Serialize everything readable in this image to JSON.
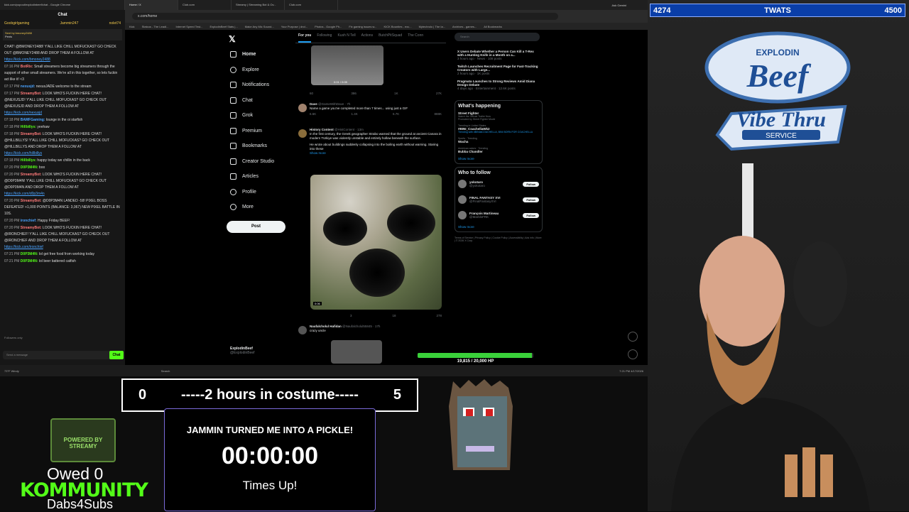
{
  "browser": {
    "tabs": [
      "Home / X",
      "Club.com",
      "Streamy | Streaming Bot & Ov...",
      "Club.com"
    ],
    "url": "x.com/home",
    "bookmarks": [
      "Kick",
      "Statcus - The Leadi...",
      "Internet Speed Test...",
      "ExplodinBeef Stats |...",
      "Make Any Mic Sound...",
      "Your Purpose | dnd...",
      "Photos - Google Ph...",
      "Fix gaming issues w...",
      "KICK Bounties - exc...",
      "Mytechrolo | The Ia...",
      "Archives - games...",
      "All Bookmarks"
    ],
    "ask_gemini": "Ask Gemini"
  },
  "chat": {
    "url": "kick.com/popout/explodinbeef/chat - Google Chrome",
    "title": "Chat",
    "top_left": "Goobgirlgaming",
    "top_mid": "Jammin247",
    "top_right": "nolet74",
    "pinned_by": "Sent by bmoney2488",
    "pinned_text": "Penis",
    "messages": [
      {
        "time": "",
        "user": "",
        "text": "CHAT! @BMONEY2488! Y'ALL LIKE CHILL MOFUCKAS? GO CHECK OUT @BMONEY2488 AND DROP THEM A FOLLOW AT",
        "link": "https://kick.com/bmoney2488"
      },
      {
        "time": "07:16 PM",
        "user": "BotRix:",
        "text": "Small streamers become big streamers through the support of other small streamers. We're all in this together, so lets fuckin act like it! <3",
        "link": ""
      },
      {
        "time": "07:17 PM",
        "user": "nexusjd:",
        "text": "nexusJADE welcome to the stream",
        "link": ""
      },
      {
        "time": "07:17 PM",
        "user": "StreamyBot:",
        "text": "LOOK WHO'S FUCKIN HERE CHAT! @NEXUSJD! Y'ALL LIKE CHILL MOFUCKAS? GO CHECK OUT @NEXUSJD AND DROP THEM A FOLLOW AT",
        "link": "https://kick.com/nexusjd"
      },
      {
        "time": "07:18 PM",
        "user": "BAMFGaming:",
        "text": "lounge in the oi starfish",
        "link": ""
      },
      {
        "time": "07:18 PM",
        "user": "Hillbillys:",
        "text": "yeehaw",
        "link": ""
      },
      {
        "time": "07:18 PM",
        "user": "StreamyBot:",
        "text": "LOOK WHO'S FUCKIN HERE CHAT! @HILLBILLYS! Y'ALL LIKE CHILL MOFUCKAS? GO CHECK OUT @HILLBILLYS AND DROP THEM A FOLLOW AT",
        "link": "https://kick.com/hillbillys"
      },
      {
        "time": "07:18 PM",
        "user": "Hillbillys:",
        "text": "happy today we chillin in the back",
        "link": ""
      },
      {
        "time": "07:20 PM",
        "user": "D0P3M4N:",
        "text": "boo",
        "link": ""
      },
      {
        "time": "07:20 PM",
        "user": "StreamyBot:",
        "text": "LOOK WHO'S FUCKIN HERE CHAT! @D0P3M4N! Y'ALL LIKE CHILL MOFUCKAS? GO CHECK OUT @D0P3M4N AND DROP THEM A FOLLOW AT",
        "link": "https://kick.com/d0p3m4n"
      },
      {
        "time": "07:20 PM",
        "user": "StreamyBot:",
        "text": "@D0P3M4N LANDED -58! PIXEL BOSS DEFEATED! +1,000 POINTS (BALANCE: 3,067) NEW PIXEL BATTLE IN 10S.",
        "link": ""
      },
      {
        "time": "07:20 PM",
        "user": "ironchief:",
        "text": "Happy Friday BEEF!",
        "link": ""
      },
      {
        "time": "07:20 PM",
        "user": "StreamyBot:",
        "text": "LOOK WHO'S FUCKIN HERE CHAT! @IRONCHIEF! Y'ALL LIKE CHILL MOFUCKAS? GO CHECK OUT @IRONCHIEF AND DROP THEM A FOLLOW AT",
        "link": "https://kick.com/ironchief"
      },
      {
        "time": "07:21 PM",
        "user": "D0P3M4N:",
        "text": "lol get free food from working today",
        "link": ""
      },
      {
        "time": "07:21 PM",
        "user": "D0P3M4N:",
        "text": "lol beer battered catfish",
        "link": ""
      }
    ],
    "followers_only": "Followers only",
    "input_placeholder": "Send a message",
    "send_label": "Chat"
  },
  "x": {
    "nav": [
      "Home",
      "Explore",
      "Notifications",
      "Chat",
      "Grok",
      "Premium",
      "Bookmarks",
      "Creator Studio",
      "Articles",
      "Profile",
      "More"
    ],
    "post_label": "Post",
    "profile_name": "ExplodinBeef",
    "profile_handle": "@ExplodinBeef",
    "feed_tabs": [
      "For you",
      "Following",
      "Kush N Tell",
      "Actions",
      "ButchPitSquad",
      "The Conn"
    ],
    "tweet1": {
      "time_code": "0:01 / 0:05",
      "stats": [
        "60",
        "386",
        "1K",
        "27K"
      ]
    },
    "tweet2": {
      "name": "Dave",
      "handle": "@GameWithDave · 7h",
      "text": "Name a game you've completed more than 7 times... using just a GIF",
      "stats": [
        "6.6K",
        "1.4K",
        "6.7K",
        "888K"
      ]
    },
    "tweet3": {
      "name": "History Content",
      "handle": "@HistContent · 13m",
      "text": "In the first century, the Greek geographer Strabo warned that the ground at ancient Canara in modern Türkiye was violently unstable and entirely hollow beneath the surface.",
      "text2": "He wrote about buildings suddenly collapsing into the boiling earth without warning. Staring into these",
      "show_more": "Show more",
      "video_time": "0:06",
      "stats": [
        "",
        "3",
        "18",
        "278"
      ]
    },
    "tweet4": {
      "name": "Naufalcholul Hafidan",
      "handle": "@Naufalcholul55845 · 17h",
      "text": "crazy uncle"
    },
    "search_placeholder": "Search",
    "news": [
      {
        "title": "X Users Debate Whether a Person Can Kill a T-Rex with a Hunting Knife in a Month on a...",
        "meta": "3 hours ago · News · 108 posts"
      },
      {
        "title": "Twitch Launches Recruitment Page for Fast-Tracking Creators with Large...",
        "meta": "2 hours ago · 1K posts"
      },
      {
        "title": "Pragmata Launches to Strong Reviews Amid Diana Design Debate",
        "meta": "4 days ago · Entertainment · 12.6K posts"
      }
    ],
    "whats_happening": "What's happening",
    "trends": [
      {
        "cat": "Watch the Official Trailer Now",
        "name": "Street Fighter",
        "sub": "Promoted by Street Fighter Movie"
      },
      {
        "cat": "Trending in United States",
        "name": "#BINI_CoachellaWk2",
        "sub": "Trending with #BINIatCOACHELLA, BINI BORN FOR COACHELLA"
      },
      {
        "cat": "Sports · Trending",
        "name": "Wacha",
        "sub": ""
      },
      {
        "cat": "American actors · Trending",
        "name": "Bubba Chandler",
        "sub": ""
      }
    ],
    "show_more": "Show more",
    "who_to_follow": "Who to follow",
    "follow": [
      {
        "name": "yokotaro",
        "handle": "@yokotaro"
      },
      {
        "name": "FINAL FANTASY XVI",
        "handle": "@FinalFantasyXVI"
      },
      {
        "name": "François Martineau",
        "handle": "@MarblsFRK"
      }
    ],
    "follow_label": "Follow",
    "footer": "Terms of Service | Privacy Policy | Cookie Policy | Accessibility | Ads info | More | © 2026 X Corp."
  },
  "hp": {
    "text": "19,815 / 20,000 HP",
    "fraction": 0.99
  },
  "taskbar": {
    "weather": "73°F Windy",
    "search": "Search",
    "time": "7:21 PM",
    "date": "4/17/2026"
  },
  "score": {
    "left": "4274",
    "center": "TWATS",
    "right": "4500"
  },
  "sign": {
    "top": "EXPLODIN",
    "main": "Beef",
    "sub": "Vibe Thru",
    "service": "SERVICE"
  },
  "costume": {
    "left": "0",
    "text": "-----2 hours in costume-----",
    "right": "5"
  },
  "timer": {
    "title": "JAMMIN TURNED ME INTO A PICKLE!",
    "time": "00:00:00",
    "status": "Times Up!"
  },
  "powered": "POWERED BY STREAMY",
  "owed": "Owed 0",
  "kommunity": "KOMMUNITY",
  "dabs": "Dabs4Subs"
}
